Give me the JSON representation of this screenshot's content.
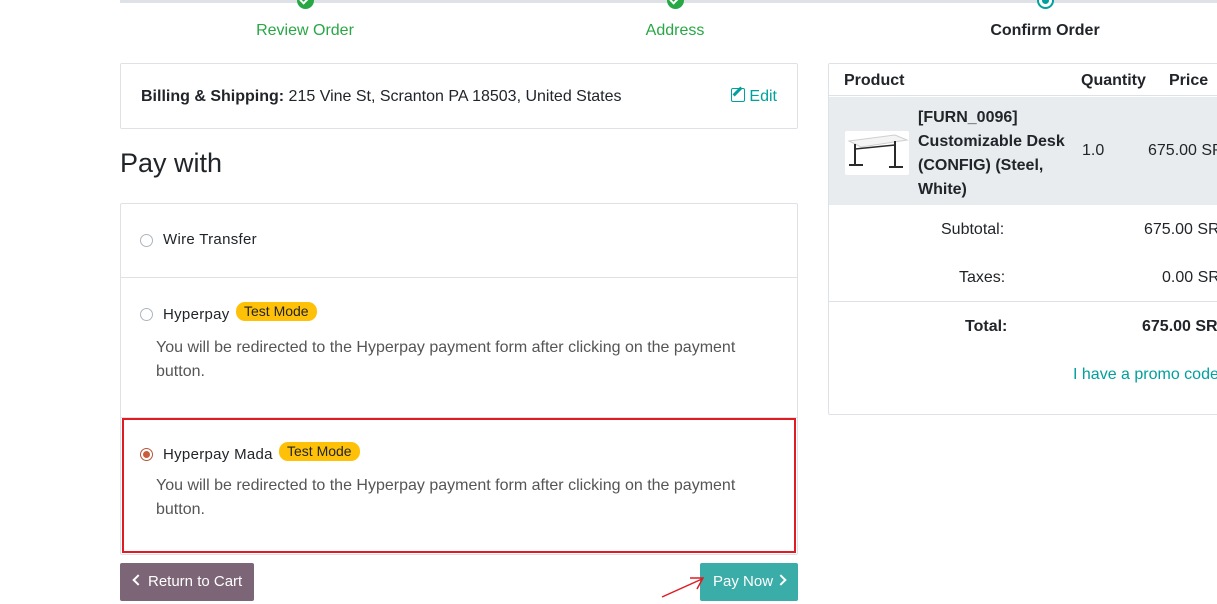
{
  "wizard": {
    "steps": [
      {
        "label": "Review Order",
        "state": "done"
      },
      {
        "label": "Address",
        "state": "done"
      },
      {
        "label": "Confirm Order",
        "state": "current"
      }
    ]
  },
  "address": {
    "label": "Billing & Shipping:",
    "value": "215 Vine St, Scranton PA 18503, United States",
    "edit_label": "Edit"
  },
  "payment": {
    "title": "Pay with",
    "options": [
      {
        "name": "Wire Transfer",
        "selected": false
      },
      {
        "name": "Hyperpay",
        "badge": "Test Mode",
        "description": "You will be redirected to the Hyperpay payment form after clicking on the payment button.",
        "selected": false
      },
      {
        "name": "Hyperpay Mada",
        "badge": "Test Mode",
        "description": "You will be redirected to the Hyperpay payment form after clicking on the payment button.",
        "selected": true
      }
    ]
  },
  "buttons": {
    "back_label": "Return to Cart",
    "pay_label": "Pay Now"
  },
  "summary": {
    "headers": {
      "product": "Product",
      "quantity": "Quantity",
      "price": "Price"
    },
    "items": [
      {
        "name": "[FURN_0096] Customizable Desk (CONFIG) (Steel, White)",
        "quantity": "1.0",
        "price": "675.00 SR"
      }
    ],
    "subtotal_label": "Subtotal:",
    "subtotal": "675.00 SR",
    "taxes_label": "Taxes:",
    "taxes": "0.00 SR",
    "total_label": "Total:",
    "total": "675.00 SR",
    "promo_label": "I have a promo code"
  },
  "colors": {
    "primary": "#00a09d",
    "success": "#28a745",
    "back_button": "#7c6576",
    "pay_button": "#3aada8",
    "badge": "#ffc107",
    "highlight_border": "#e01b24"
  }
}
